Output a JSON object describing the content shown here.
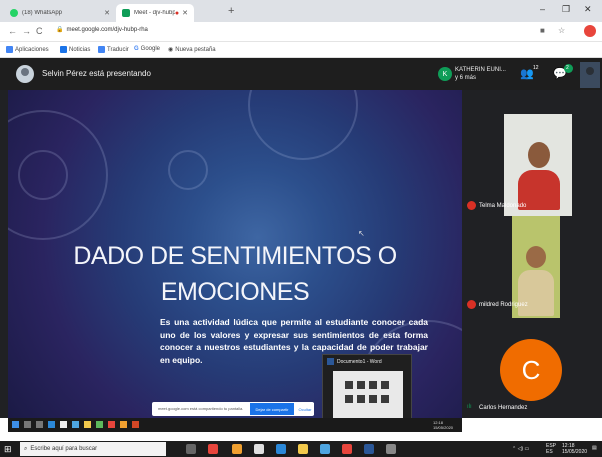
{
  "browser": {
    "tabs": [
      {
        "label": "(18) WhatsApp",
        "favicon_color": "#25d366"
      },
      {
        "label": "Meet - djv-hubp-rha",
        "favicon_color": "#0f9d58"
      },
      {
        "label": "",
        "favicon_color": "#d93025"
      }
    ],
    "url": "meet.google.com/djv-hubp-rha",
    "bookmarks": [
      {
        "label": "Aplicaciones",
        "icon": "apps-grid-icon",
        "color": "#4285f4"
      },
      {
        "label": "Noticias",
        "icon": "news-icon",
        "color": "#1a73e8"
      },
      {
        "label": "Traducir",
        "icon": "translate-icon",
        "color": "#4285f4"
      },
      {
        "label": "Google",
        "icon": "google-icon",
        "color": "#ffffff"
      },
      {
        "label": "Nueva pestaña",
        "icon": "globe-icon",
        "color": "#ffffff"
      }
    ]
  },
  "meet": {
    "presenting_label": "Selvin Pérez está presentando",
    "attendee_initial": "K",
    "attendee_line1": "KATHERIN EUNI...",
    "attendee_line2": "y 6 más",
    "participants_count": "12",
    "chat_count": "2"
  },
  "slide": {
    "title_line1": "DADO DE SENTIMIENTOS O",
    "title_line2": "EMOCIONES",
    "body": "Es una actividad lúdica que permite al  estudiante conocer cada uno de los valores y expresar  sus sentimientos de esta forma conocer  a nuestros  estudiantes  y la capacidad de poder trabajar en equipo."
  },
  "share_bar": {
    "text": "meet.google.com está compartiendo tu pantalla.",
    "stop_label": "Dejar de compartir",
    "hide_label": "Ocultar"
  },
  "word_window": {
    "title": "Documento1 - Word"
  },
  "participants": [
    {
      "name": "Telma Maldonado"
    },
    {
      "name": "mildred Rodriguez"
    },
    {
      "name": "Carlos Hernandez",
      "initial": "C",
      "avatar_color": "#f06c00"
    }
  ],
  "inner_clock": {
    "time": "12:18",
    "date": "15/05/2020"
  },
  "taskbar": {
    "search_placeholder": "Escribe aquí para buscar",
    "lang": "ESP",
    "region": "ES",
    "time": "12:18",
    "date": "15/05/2020"
  }
}
